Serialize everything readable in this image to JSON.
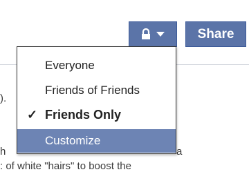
{
  "share_controls": {
    "privacy_button": {
      "lock_icon": "lock-icon",
      "arrow_icon": "caret-down-icon"
    },
    "share_label": "Share"
  },
  "privacy_menu": {
    "items": [
      {
        "label": "Everyone",
        "selected": false,
        "highlighted": false
      },
      {
        "label": "Friends of Friends",
        "selected": false,
        "highlighted": false
      },
      {
        "label": "Friends Only",
        "selected": true,
        "highlighted": false
      },
      {
        "label": "Customize",
        "selected": false,
        "highlighted": true
      }
    ],
    "check_glyph": "✓"
  },
  "background_text": {
    "frag_left_mid": ").",
    "frag_left_bottom": "h",
    "frag_right_bottom": "a",
    "frag_bottom_line": ": of white \"hairs\" to boost the"
  },
  "colors": {
    "button_bg": "#5b74a8",
    "highlight_bg": "#6d84b4",
    "menu_border": "#333333"
  }
}
